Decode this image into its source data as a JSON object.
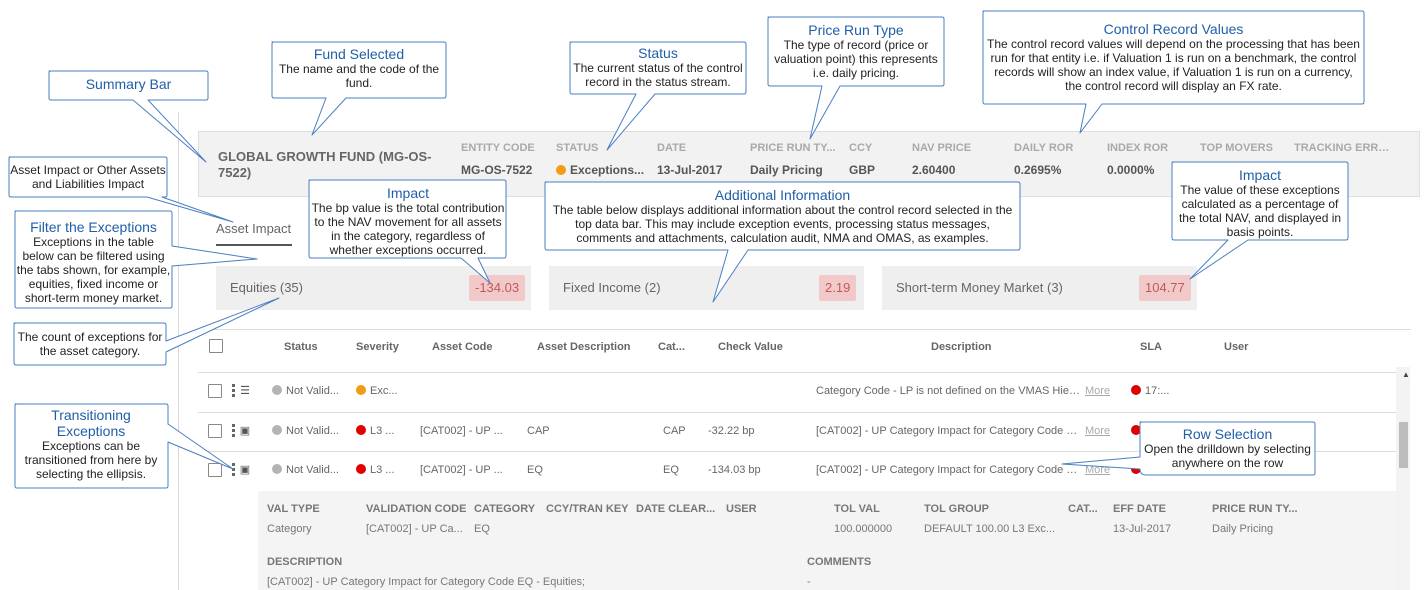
{
  "summary": {
    "fund_name": "GLOBAL GROWTH FUND (MG-OS-7522)",
    "columns": [
      {
        "label": "ENTITY CODE",
        "value": "MG-OS-7522"
      },
      {
        "label": "STATUS",
        "value": "Exceptions..."
      },
      {
        "label": "DATE",
        "value": "13-Jul-2017"
      },
      {
        "label": "PRICE RUN TY...",
        "value": "Daily Pricing"
      },
      {
        "label": "CCY",
        "value": "GBP"
      },
      {
        "label": "NAV PRICE",
        "value": "2.60400"
      },
      {
        "label": "DAILY ROR",
        "value": "0.2695%"
      },
      {
        "label": "INDEX ROR",
        "value": "0.0000%"
      },
      {
        "label": "TOP MOVERS",
        "value": ""
      },
      {
        "label": "TRACKING ERROR",
        "value": ""
      }
    ]
  },
  "tab": {
    "label": "Asset Impact"
  },
  "categories": [
    {
      "name": "Equities (35)",
      "bp": "-134.03"
    },
    {
      "name": "Fixed Income (2)",
      "bp": "2.19"
    },
    {
      "name": "Short-term Money Market (3)",
      "bp": "104.77"
    }
  ],
  "table": {
    "headers": [
      "Status",
      "Severity",
      "Asset Code",
      "Asset Description",
      "Cat...",
      "Check Value",
      "Description",
      "SLA",
      "User"
    ],
    "rows": [
      {
        "status": "Not Valid...",
        "severity": "Exc...",
        "asset_code": "",
        "asset_desc": "",
        "cat": "",
        "check_value": "",
        "description": "Category Code - LP is not defined on the VMAS Hiera...",
        "more": "More",
        "sla": "17:...",
        "icon": "layers-icon"
      },
      {
        "status": "Not Valid...",
        "severity": "L3 ...",
        "asset_code": "[CAT002] - UP ...",
        "asset_desc": "CAP",
        "cat": "CAP",
        "check_value": "-32.22 bp",
        "description": "[CAT002] - UP Category Impact for Category Code C...",
        "more": "More",
        "sla": "",
        "icon": "cube-icon"
      },
      {
        "status": "Not Valid...",
        "severity": "L3 ...",
        "asset_code": "[CAT002] - UP ...",
        "asset_desc": "EQ",
        "cat": "EQ",
        "check_value": "-134.03 bp",
        "description": "[CAT002] - UP Category Impact for Category Code E...",
        "more": "More",
        "sla": "",
        "icon": "cube-icon"
      }
    ]
  },
  "drilldown": {
    "fields": [
      {
        "label": "VAL TYPE",
        "value": "Category"
      },
      {
        "label": "VALIDATION CODE",
        "value": "[CAT002] - UP Ca..."
      },
      {
        "label": "CATEGORY",
        "value": "EQ"
      },
      {
        "label": "CCY/TRAN KEY",
        "value": ""
      },
      {
        "label": "DATE CLEAR...",
        "value": ""
      },
      {
        "label": "USER",
        "value": ""
      },
      {
        "label": "TOL VAL",
        "value": "100.000000"
      },
      {
        "label": "TOL GROUP",
        "value": "DEFAULT 100.00 L3 Exc..."
      },
      {
        "label": "CAT...",
        "value": ""
      },
      {
        "label": "EFF DATE",
        "value": "13-Jul-2017"
      },
      {
        "label": "PRICE RUN TY...",
        "value": "Daily Pricing"
      }
    ],
    "description_label": "DESCRIPTION",
    "description_value": "[CAT002] - UP Category Impact for Category Code EQ - Equities;",
    "comments_label": "COMMENTS",
    "comments_value": "-"
  },
  "callouts": {
    "summary_bar": {
      "title": "Summary Bar"
    },
    "fund_selected": {
      "title": "Fund Selected",
      "body": "The name and the code of the fund."
    },
    "status": {
      "title": "Status",
      "body": "The current status of the control record in the status stream."
    },
    "price_run_type": {
      "title": "Price Run Type",
      "body": "The type of record (price or valuation point) this represents i.e. daily pricing."
    },
    "control_record": {
      "title": "Control Record Values",
      "body": "The control record values will depend on the processing that has been run for that entity i.e. if Valuation 1 is run on a benchmark, the control records will show an index value, if Valuation 1 is run on a currency, the control record will display an FX rate."
    },
    "asset_impact": {
      "body": "Asset Impact or Other Assets and Liabilities Impact"
    },
    "filter": {
      "title": "Filter the Exceptions",
      "body": "Exceptions in the table below can be filtered using the tabs shown, for example, equities, fixed income or short-term money market."
    },
    "impact_left": {
      "title": "Impact",
      "body": "The bp value is the total contribution to the NAV movement for all assets in the category, regardless of whether exceptions occurred."
    },
    "additional": {
      "title": "Additional Information",
      "body": "The table below displays additional information about the control record selected in the top data bar. This may include exception events, processing status messages, comments and attachments, calculation audit, NMA and OMAS, as examples."
    },
    "impact_right": {
      "title": "Impact",
      "body": "The value of these exceptions calculated as a percentage of the total NAV, and displayed in basis points."
    },
    "count": {
      "body": "The count of exceptions for the asset category."
    },
    "transitioning": {
      "title": "Transitioning Exceptions",
      "body": "Exceptions can be transitioned from here by selecting the ellipsis."
    },
    "row_selection": {
      "title": "Row Selection",
      "body": "Open the drilldown by selecting anywhere on the row"
    }
  },
  "colors": {
    "accent": "#1f5fa8",
    "callout_border": "#4a7fc1",
    "impact_badge": "#f2c9c9",
    "exception_orange": "#f39c12",
    "exception_red": "#e00000"
  }
}
